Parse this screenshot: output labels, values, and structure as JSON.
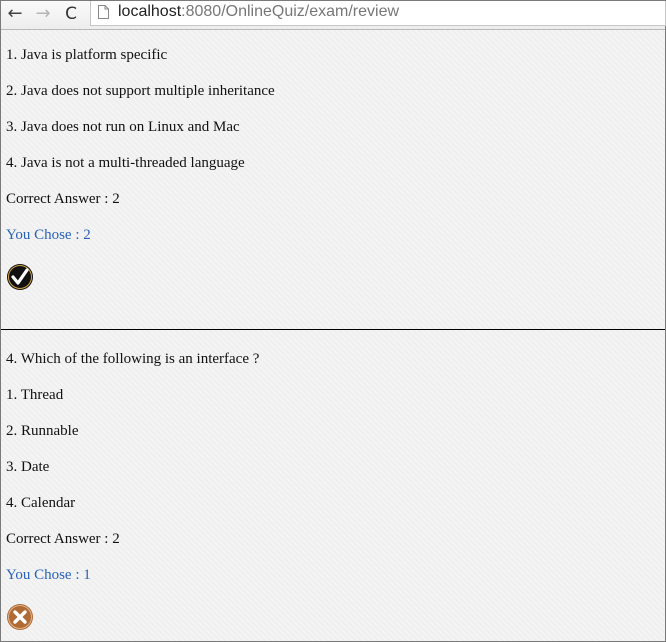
{
  "browser": {
    "url_host": "localhost",
    "url_rest": ":8080/OnlineQuiz/exam/review",
    "back_icon": "←",
    "forward_icon": "→",
    "reload_icon": "C"
  },
  "review": {
    "block1": {
      "options": [
        "1. Java is platform specific",
        "2. Java does not support multiple inheritance",
        "3. Java does not run on Linux and Mac",
        "4. Java is not a multi-threaded language"
      ],
      "correct_answer": "Correct Answer : 2",
      "you_chose": "You Chose : 2",
      "result_icon": "check-icon"
    },
    "block2": {
      "question": "4. Which of the following is an interface ?",
      "options": [
        "1. Thread",
        "2. Runnable",
        "3. Date",
        "4. Calendar"
      ],
      "correct_answer": "Correct Answer : 2",
      "you_chose": "You Chose : 1",
      "result_icon": "cross-icon"
    }
  },
  "colors": {
    "you_chose_text": "#2a62b6",
    "cross_badge": "#b06a36"
  }
}
